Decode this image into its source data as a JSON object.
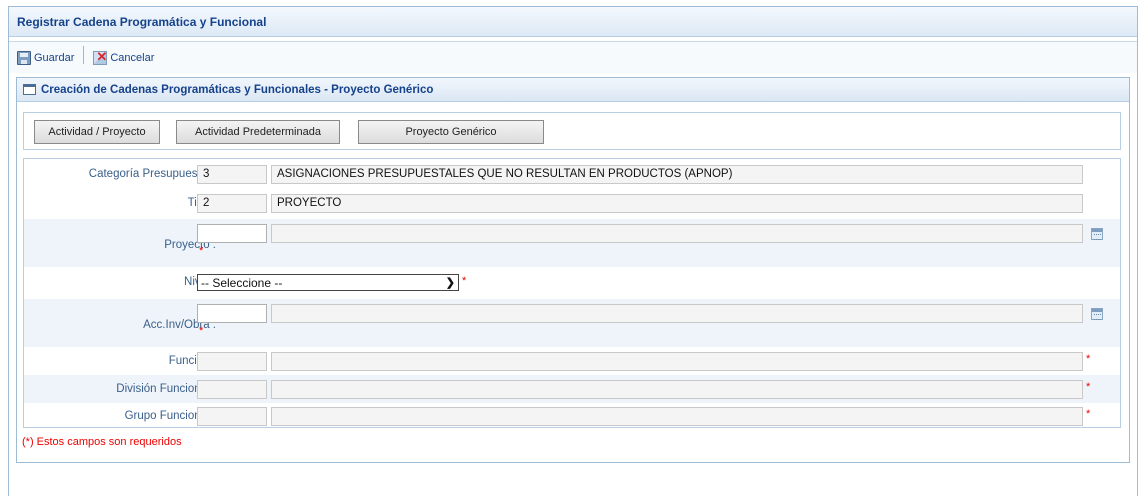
{
  "window": {
    "title": "Registrar Cadena Programática y Funcional"
  },
  "toolbar": {
    "save_label": "Guardar",
    "cancel_label": "Cancelar"
  },
  "panel": {
    "title": "Creación de Cadenas Programáticas y Funcionales - Proyecto Genérico"
  },
  "tabs": [
    {
      "label": "Actividad / Proyecto"
    },
    {
      "label": "Actividad Predeterminada"
    },
    {
      "label": "Proyecto Genérico"
    }
  ],
  "form": {
    "categoria": {
      "label": "Categoría Presupuestal :",
      "code": "3",
      "description": "ASIGNACIONES PRESUPUESTALES QUE NO RESULTAN EN PRODUCTOS (APNOP)"
    },
    "tipo": {
      "label": "Tipo :",
      "code": "2",
      "description": "PROYECTO"
    },
    "proyecto": {
      "label": "Proyecto :",
      "code": "",
      "description": "",
      "required": "*"
    },
    "nivel": {
      "label": "Nivel :",
      "selected": "-- Seleccione --",
      "required": "*"
    },
    "acc_inv": {
      "label": "Acc.Inv/Obra :",
      "code": "",
      "description": "",
      "required": "*"
    },
    "funcion": {
      "label": "Función :",
      "code": "",
      "description": "",
      "required": "*"
    },
    "division": {
      "label": "División Funcional :",
      "code": "",
      "description": "",
      "required": "*"
    },
    "grupo": {
      "label": "Grupo Funcional :",
      "code": "",
      "description": "",
      "required": "*"
    }
  },
  "required_note": "(*) Estos campos son requeridos",
  "icons": {
    "save": "save-icon",
    "cancel": "cancel-icon",
    "panel": "window-icon",
    "calendar": "calendar-icon",
    "select": "chevron-down-icon"
  }
}
